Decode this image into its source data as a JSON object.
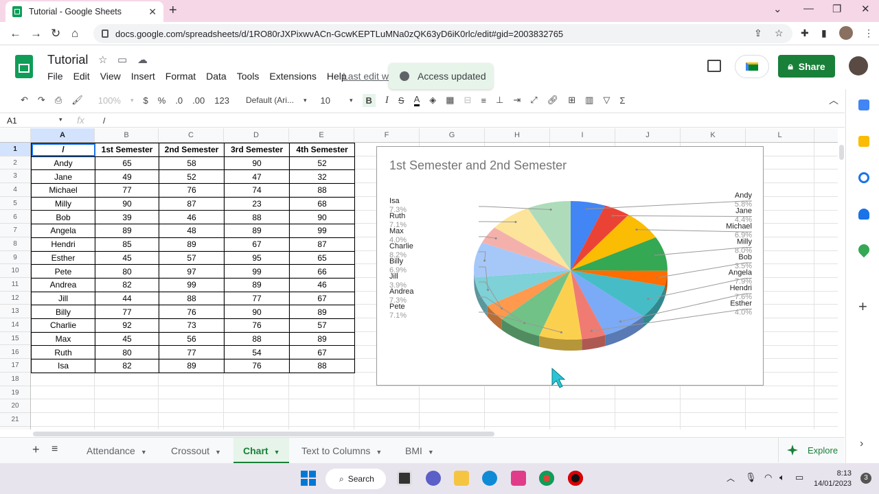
{
  "browser": {
    "tab_title": "Tutorial - Google Sheets",
    "url": "docs.google.com/spreadsheets/d/1RO80rJXPixwvACn-GcwKEPTLuMNa0zQK63yD6iK0rlc/edit#gid=2003832765"
  },
  "doc": {
    "title": "Tutorial",
    "menu": [
      "File",
      "Edit",
      "View",
      "Insert",
      "Format",
      "Data",
      "Tools",
      "Extensions",
      "Help"
    ],
    "last_edit": "Last edit wa",
    "share_label": "Share",
    "toast": "Access updated"
  },
  "toolbar": {
    "zoom": "100%",
    "currency": "$",
    "percent": "%",
    "dec_less": ".0",
    "dec_more": ".00",
    "number_format": "123",
    "font": "Default (Ari...",
    "font_size": "10"
  },
  "formula": {
    "cell_ref": "A1",
    "fx": "fx",
    "value": "/"
  },
  "grid": {
    "columns": [
      "A",
      "B",
      "C",
      "D",
      "E",
      "F",
      "G",
      "H",
      "I",
      "J",
      "K",
      "L"
    ],
    "rows": [
      "1",
      "2",
      "3",
      "4",
      "5",
      "6",
      "7",
      "8",
      "9",
      "10",
      "11",
      "12",
      "13",
      "14",
      "15",
      "16",
      "17",
      "18",
      "19",
      "20",
      "21"
    ],
    "header": [
      "/",
      "1st Semester",
      "2nd Semester",
      "3rd Semester",
      "4th Semester"
    ],
    "data": [
      [
        "Andy",
        "65",
        "58",
        "90",
        "52"
      ],
      [
        "Jane",
        "49",
        "52",
        "47",
        "32"
      ],
      [
        "Michael",
        "77",
        "76",
        "74",
        "88"
      ],
      [
        "Milly",
        "90",
        "87",
        "23",
        "68"
      ],
      [
        "Bob",
        "39",
        "46",
        "88",
        "90"
      ],
      [
        "Angela",
        "89",
        "48",
        "89",
        "99"
      ],
      [
        "Hendri",
        "85",
        "89",
        "67",
        "87"
      ],
      [
        "Esther",
        "45",
        "57",
        "95",
        "65"
      ],
      [
        "Pete",
        "80",
        "97",
        "99",
        "66"
      ],
      [
        "Andrea",
        "82",
        "99",
        "89",
        "46"
      ],
      [
        "Jill",
        "44",
        "88",
        "77",
        "67"
      ],
      [
        "Billy",
        "77",
        "76",
        "90",
        "89"
      ],
      [
        "Charlie",
        "92",
        "73",
        "76",
        "57"
      ],
      [
        "Max",
        "45",
        "56",
        "88",
        "89"
      ],
      [
        "Ruth",
        "80",
        "77",
        "54",
        "67"
      ],
      [
        "Isa",
        "82",
        "89",
        "76",
        "88"
      ]
    ]
  },
  "chart_data": {
    "type": "pie",
    "title": "1st Semester and 2nd Semester",
    "categories": [
      "Andy",
      "Jane",
      "Michael",
      "Milly",
      "Bob",
      "Angela",
      "Hendri",
      "Esther",
      "Pete",
      "Andrea",
      "Jill",
      "Billy",
      "Charlie",
      "Max",
      "Ruth",
      "Isa"
    ],
    "values": [
      5.8,
      4.4,
      6.9,
      8.0,
      3.5,
      7.9,
      7.6,
      4.0,
      7.1,
      7.3,
      3.9,
      6.9,
      8.2,
      4.0,
      7.1,
      7.3
    ],
    "labels": [
      "5.8%",
      "4.4%",
      "6.9%",
      "8.0%",
      "3.5%",
      "7.9%",
      "7.6%",
      "4.0%",
      "7.1%",
      "7.3%",
      "3.9%",
      "6.9%",
      "8.2%",
      "4.0%",
      "7.1%",
      "7.3%"
    ],
    "colors": [
      "#4285f4",
      "#ea4335",
      "#fbbc04",
      "#34a853",
      "#ff6d01",
      "#46bdc6",
      "#7baaf7",
      "#f07b72",
      "#fcd04f",
      "#71c287",
      "#ff994d",
      "#7ed1d7",
      "#a6c8f9",
      "#f4b1ab",
      "#fde49b",
      "#aedcba"
    ],
    "legend": "labels"
  },
  "sheets": {
    "tabs": [
      "Attendance",
      "Crossout",
      "Chart",
      "Text to Columns",
      "BMI"
    ],
    "active": "Chart",
    "explore": "Explore"
  },
  "taskbar": {
    "search": "Search",
    "time": "8:13",
    "date": "14/01/2023"
  }
}
